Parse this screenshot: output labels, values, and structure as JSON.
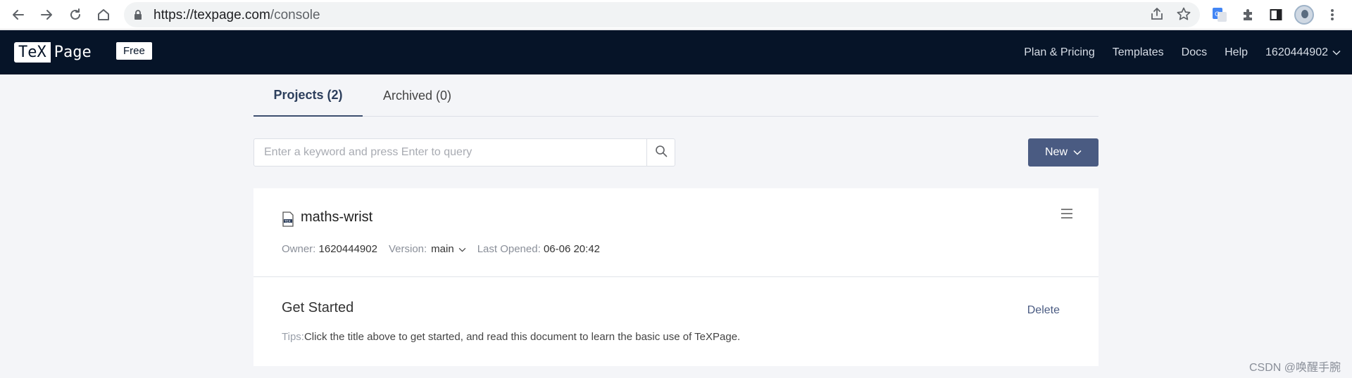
{
  "browser": {
    "url_host": "https://texpage.com",
    "url_path": "/console",
    "icons": [
      "back-arrow-icon",
      "forward-arrow-icon",
      "reload-icon",
      "home-icon",
      "lock-icon",
      "share-icon",
      "star-icon",
      "translate-icon",
      "extensions-icon",
      "sidepanel-icon",
      "avatar",
      "more-vert-icon"
    ]
  },
  "header": {
    "logo_left": "TeX",
    "logo_right": "Page",
    "plan_badge": "Free",
    "nav": {
      "plan_pricing": "Plan & Pricing",
      "templates": "Templates",
      "docs": "Docs",
      "help": "Help",
      "user": "1620444902"
    }
  },
  "tabs": {
    "projects": "Projects (2)",
    "archived": "Archived (0)"
  },
  "search": {
    "placeholder": "Enter a keyword and press Enter to query"
  },
  "new_button": {
    "label": "New"
  },
  "projects": [
    {
      "title": "maths-wrist",
      "owner_label": "Owner:",
      "owner": "1620444902",
      "version_label": "Version:",
      "version": "main",
      "opened_label": "Last Opened:",
      "opened": "06-06 20:42"
    }
  ],
  "get_started": {
    "title": "Get Started",
    "delete": "Delete",
    "tips_label": "Tips:",
    "tips_text": "Click the title above to get started, and read this document to learn the basic use of TeXPage."
  },
  "watermark": "CSDN @唤醒手腕",
  "colors": {
    "header_bg": "#061428",
    "accent": "#4a5b82",
    "page_bg": "#f4f5f8"
  }
}
